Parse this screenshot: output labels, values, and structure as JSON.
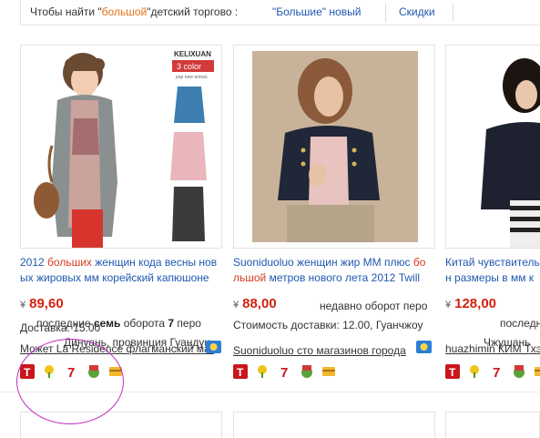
{
  "topbar": {
    "query_prefix": "Чтобы найти \"",
    "query_keyword": "большой",
    "query_suffix": "\"детский торгово :",
    "link1": "\"Большие\" новый",
    "link2": "Скидки"
  },
  "products": [
    {
      "image_label": "KELIXUAN",
      "image_badge": "3 color",
      "image_badge_sub": "pop new arrival.",
      "title_line1_pre": "2012 ",
      "title_line1_hl": "больших",
      "title_line1_post": " женщин кода весны нов",
      "title_line2_pre": "ых жировых мм корейский капюшоне",
      "title_line2_hl": "",
      "title_line2_post": "",
      "currency": "¥",
      "price": "89,60",
      "sales_prefix": "последние ",
      "sales_bold": "семь",
      "sales_mid": " оборота ",
      "sales_count": "7",
      "sales_suffix": " перо",
      "shipping": "Доставка: 15.00",
      "location": "Динуань, провинция Гуандун",
      "seller": "Может La Residence флагманский маг"
    },
    {
      "title_line1_pre": "Suoniduoluo женщин жир ММ плюс ",
      "title_line1_hl": "бо",
      "title_line1_post": "",
      "title_line2_pre": "",
      "title_line2_hl": "льшой",
      "title_line2_post": " метров нового лета 2012 Twill",
      "currency": "¥",
      "price": "88,00",
      "sales_prefix": "недавно оборот перо",
      "sales_bold": "",
      "sales_mid": "",
      "sales_count": "",
      "sales_suffix": "",
      "shipping": "Стоимость доставки: 12.00, Гуанчжоу",
      "location": "",
      "seller": "Suoniduoluo сто магазинов города"
    },
    {
      "title_line1_pre": "Китай чувствитель",
      "title_line1_hl": "",
      "title_line1_post": "",
      "title_line2_pre": "н размеры в мм к",
      "title_line2_hl": "",
      "title_line2_post": "",
      "currency": "¥",
      "price": "128,00",
      "sales_prefix": "последние ",
      "sales_bold": "т",
      "sales_mid": "",
      "sales_count": "",
      "sales_suffix": "",
      "shipping": "",
      "location": "Чжушань",
      "seller": "huazhimin КИМ Тхэ"
    }
  ],
  "icon_set": [
    "tmall-icon",
    "flower-icon",
    "seven-day-icon",
    "authentic-icon",
    "credit-card-icon"
  ],
  "colors": {
    "link": "#1f58b0",
    "price": "#d2220f",
    "keyword": "#e4751d",
    "annotation": "#c22cc2"
  }
}
